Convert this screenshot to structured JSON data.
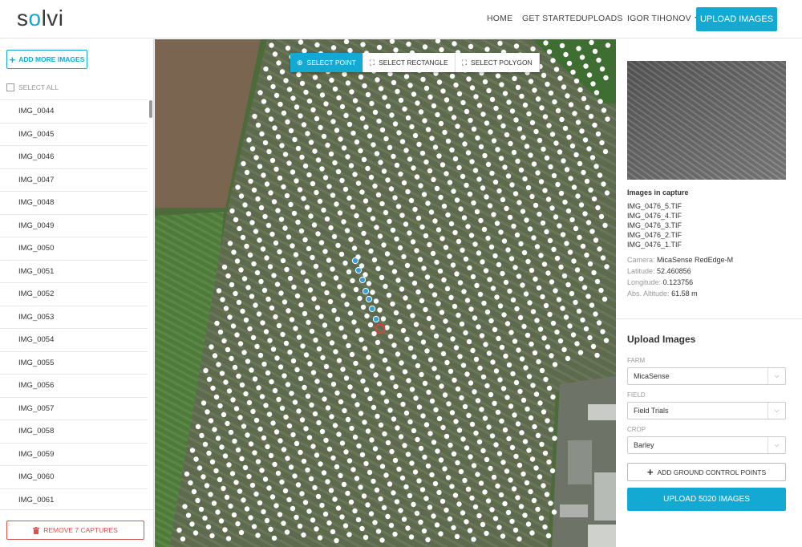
{
  "app": {
    "logo_prefix": "s",
    "logo_o": "o",
    "logo_suffix": "lvi"
  },
  "nav": {
    "home": "HOME",
    "get_started": "GET STARTED",
    "uploads": "UPLOADS",
    "user": "IGOR TIHONOV",
    "upload_images": "UPLOAD IMAGES"
  },
  "sidebar": {
    "add_more": "ADD MORE IMAGES",
    "select_all": "SELECT ALL",
    "files": [
      "IMG_0044",
      "IMG_0045",
      "IMG_0046",
      "IMG_0047",
      "IMG_0048",
      "IMG_0049",
      "IMG_0050",
      "IMG_0051",
      "IMG_0052",
      "IMG_0053",
      "IMG_0054",
      "IMG_0055",
      "IMG_0056",
      "IMG_0057",
      "IMG_0058",
      "IMG_0059",
      "IMG_0060",
      "IMG_0061"
    ],
    "remove": "REMOVE 7 CAPTURES"
  },
  "map": {
    "tools": {
      "point": "SELECT POINT",
      "rectangle": "SELECT RECTANGLE",
      "polygon": "SELECT POLYGON"
    }
  },
  "capture": {
    "title": "Images in capture",
    "images": [
      "IMG_0476_5.TIF",
      "IMG_0476_4.TIF",
      "IMG_0476_3.TIF",
      "IMG_0476_2.TIF",
      "IMG_0476_1.TIF"
    ],
    "camera_label": "Camera:",
    "camera": "MicaSense RedEdge-M",
    "latitude_label": "Latitude:",
    "latitude": "52.460856",
    "longitude_label": "Longitude:",
    "longitude": "0.123756",
    "altitude_label": "Abs. Altitude:",
    "altitude": "61.58 m"
  },
  "upload": {
    "title": "Upload Images",
    "farm_label": "FARM",
    "farm": "MicaSense",
    "field_label": "FIELD",
    "field": "Field Trials",
    "crop_label": "CROP",
    "crop": "Barley",
    "gcp": "ADD GROUND CONTROL POINTS",
    "submit": "UPLOAD 5020 IMAGES"
  },
  "colors": {
    "accent": "#13a9d3",
    "danger": "#d9534f",
    "selected_point": "#e04040",
    "selected_track": "#3aa0d8"
  }
}
